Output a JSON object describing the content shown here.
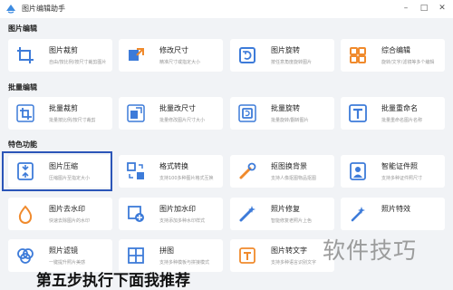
{
  "app": {
    "title": "图片编辑助手"
  },
  "window": {
    "minimize_glyph": "–",
    "maximize_glyph": "□",
    "close_glyph": "✕"
  },
  "sections": {
    "edit": "图片编辑",
    "batch": "批量编辑",
    "special": "特色功能"
  },
  "cards": {
    "crop": {
      "title": "图片裁剪",
      "desc": "自由/按比例/按尺寸裁剪图片",
      "icon": "crop-icon",
      "color": "#3d7bd9"
    },
    "resize": {
      "title": "修改尺寸",
      "desc": "精准尺寸或指定大小",
      "icon": "resize-icon",
      "color": "#3d7bd9"
    },
    "rotate": {
      "title": "图片旋转",
      "desc": "按任意角度旋转图片",
      "icon": "rotate-icon",
      "color": "#3d7bd9"
    },
    "combo": {
      "title": "综合编辑",
      "desc": "旋转/文字/滤镜等多个编辑",
      "icon": "grid-icon",
      "color": "#f08a2c"
    },
    "batch_crop": {
      "title": "批量裁剪",
      "desc": "批量按比例/按尺寸裁剪",
      "icon": "batch-crop-icon",
      "color": "#3d7bd9"
    },
    "batch_resize": {
      "title": "批量改尺寸",
      "desc": "批量修改图片尺寸大小",
      "icon": "batch-resize-icon",
      "color": "#3d7bd9"
    },
    "batch_rotate": {
      "title": "批量旋转",
      "desc": "批量旋转/翻转图片",
      "icon": "batch-rotate-icon",
      "color": "#3d7bd9"
    },
    "batch_rename": {
      "title": "批量重命名",
      "desc": "批量重命名图片名称",
      "icon": "rename-icon",
      "color": "#3d7bd9"
    },
    "compress": {
      "title": "图片压缩",
      "desc": "压缩图片至指定大小",
      "icon": "compress-icon",
      "color": "#3d7bd9"
    },
    "convert": {
      "title": "格式转换",
      "desc": "支持100多种图片格式互换",
      "icon": "convert-icon",
      "color": "#3d7bd9"
    },
    "matting": {
      "title": "抠图换背景",
      "desc": "支持人像抠图物品抠图",
      "icon": "matting-icon",
      "color": "#f08a2c"
    },
    "id_photo": {
      "title": "智能证件照",
      "desc": "支持多种证件照尺寸",
      "icon": "id-photo-icon",
      "color": "#3d7bd9"
    },
    "dewatermark": {
      "title": "图片去水印",
      "desc": "快速去除图片的水印",
      "icon": "dewatermark-icon",
      "color": "#f08a2c"
    },
    "add_watermark": {
      "title": "图片加水印",
      "desc": "支持添加多种水印样式",
      "icon": "add-watermark-icon",
      "color": "#3d7bd9"
    },
    "repair": {
      "title": "照片修复",
      "desc": "智能修复老照片上色",
      "icon": "magic-wand-icon",
      "color": "#3d7bd9"
    },
    "effects": {
      "title": "照片特效",
      "desc": "",
      "icon": "effects-icon",
      "color": "#3d7bd9"
    },
    "filter": {
      "title": "照片滤镜",
      "desc": "一键提升照片美感",
      "icon": "filter-icon",
      "color": "#3d7bd9"
    },
    "collage": {
      "title": "拼图",
      "desc": "支持多种模板与拼接模式",
      "icon": "collage-icon",
      "color": "#3d7bd9"
    },
    "ocr": {
      "title": "图片转文字",
      "desc": "支持多种语言识别文字",
      "icon": "ocr-icon",
      "color": "#f08a2c"
    }
  },
  "watermark_text": "软件技巧",
  "caption": "第五步执行下面我推荐"
}
